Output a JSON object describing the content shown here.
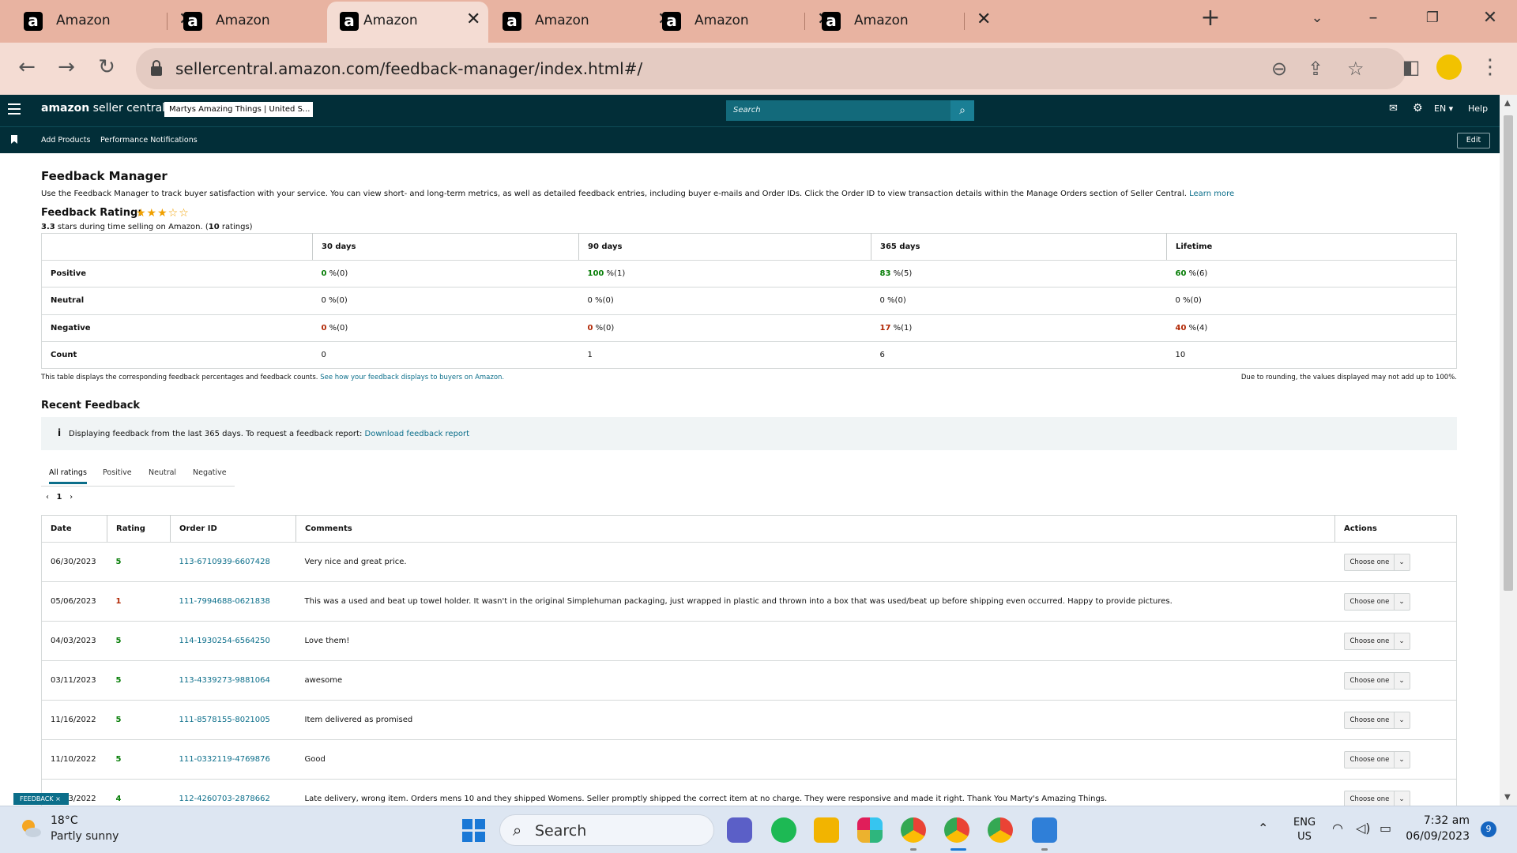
{
  "browser": {
    "tabs": [
      {
        "title": "Amazon",
        "active": false
      },
      {
        "title": "Amazon",
        "active": false
      },
      {
        "title": "Amazon",
        "active": true
      },
      {
        "title": "Amazon",
        "active": false
      },
      {
        "title": "Amazon",
        "active": false
      },
      {
        "title": "Amazon",
        "active": false
      }
    ],
    "url": "sellercentral.amazon.com/feedback-manager/index.html#/"
  },
  "header": {
    "logo_bold": "amazon",
    "logo_rest": " seller central",
    "account": "Martys Amazing Things | United S...",
    "search_placeholder": "Search",
    "language": "EN ▾",
    "help": "Help"
  },
  "subnav": {
    "links": [
      "Add Products",
      "Performance Notifications"
    ],
    "edit": "Edit"
  },
  "page": {
    "title": "Feedback Manager",
    "description": "Use the Feedback Manager to track buyer satisfaction with your service. You can view short- and long-term metrics, as well as detailed feedback entries, including buyer e-mails and Order IDs. Click the Order ID to view transaction details within the Manage Orders section of Seller Central.",
    "learn_more": "Learn more",
    "rating_label": "Feedback Rating:",
    "rating_value": 3.3,
    "rating_stars_text": "★★★☆☆",
    "rating_sub_bold": "3.3",
    "rating_sub_mid": " stars during time selling on Amazon. (",
    "rating_sub_count": "10",
    "rating_sub_end": " ratings)"
  },
  "metrics": {
    "columns": [
      "30 days",
      "90 days",
      "365 days",
      "Lifetime"
    ],
    "rows": [
      {
        "label": "Positive",
        "cells": [
          [
            "0",
            " %(0)"
          ],
          [
            "100",
            " %(1)"
          ],
          [
            "83",
            " %(5)"
          ],
          [
            "60",
            " %(6)"
          ]
        ]
      },
      {
        "label": "Neutral",
        "cells": [
          [
            "0",
            " %(0)"
          ],
          [
            "0",
            " %(0)"
          ],
          [
            "0",
            " %(0)"
          ],
          [
            "0",
            " %(0)"
          ]
        ]
      },
      {
        "label": "Negative",
        "cells": [
          [
            "0",
            " %(0)"
          ],
          [
            "0",
            " %(0)"
          ],
          [
            "17",
            " %(1)"
          ],
          [
            "40",
            " %(4)"
          ]
        ]
      },
      {
        "label": "Count",
        "cells": [
          [
            "0",
            ""
          ],
          [
            "1",
            ""
          ],
          [
            "6",
            ""
          ],
          [
            "10",
            ""
          ]
        ]
      }
    ],
    "note_left": "This table displays the corresponding feedback percentages and feedback counts.",
    "note_link": "See how your feedback displays to buyers on Amazon.",
    "note_right": "Due to rounding, the values displayed may not add up to 100%."
  },
  "recent": {
    "title": "Recent Feedback",
    "alert_text": "Displaying feedback from the last 365 days. To request a feedback report:",
    "alert_link": "Download feedback report",
    "filters": [
      "All ratings",
      "Positive",
      "Neutral",
      "Negative"
    ],
    "page": "1",
    "columns": [
      "Date",
      "Rating",
      "Order ID",
      "Comments",
      "Actions"
    ],
    "action_label": "Choose one",
    "rows": [
      {
        "date": "06/30/2023",
        "rating": "5",
        "order": "113-6710939-6607428",
        "comment": "Very nice and great price."
      },
      {
        "date": "05/06/2023",
        "rating": "1",
        "order": "111-7994688-0621838",
        "comment": "This was a used and beat up towel holder. It wasn't in the original Simplehuman packaging, just wrapped in plastic and thrown into a box that was used/beat up before shipping even occurred. Happy to provide pictures."
      },
      {
        "date": "04/03/2023",
        "rating": "5",
        "order": "114-1930254-6564250",
        "comment": "Love them!"
      },
      {
        "date": "03/11/2023",
        "rating": "5",
        "order": "113-4339273-9881064",
        "comment": "awesome"
      },
      {
        "date": "11/16/2022",
        "rating": "5",
        "order": "111-8578155-8021005",
        "comment": "Item delivered as promised"
      },
      {
        "date": "11/10/2022",
        "rating": "5",
        "order": "111-0332119-4769876",
        "comment": "Good"
      },
      {
        "date": "10/13/2022",
        "rating": "4",
        "order": "112-4260703-2878662",
        "comment": "Late delivery, wrong item. Orders mens 10 and they shipped Womens. Seller promptly shipped the correct item at no charge. They were responsive and made it right. Thank You Marty's Amazing Things."
      }
    ],
    "feedback_badge": "FEEDBACK ×"
  },
  "taskbar": {
    "temperature": "18°C",
    "condition": "Partly sunny",
    "search_label": "Search",
    "lang_line1": "ENG",
    "lang_line2": "US",
    "time": "7:32 am",
    "date": "06/09/2023",
    "notifications": "9"
  },
  "colors": {
    "tabbar": "#e8b3a1",
    "toolbar": "#f4dcd3",
    "sc_header": "#022e38",
    "link": "#0b6e8a",
    "positive": "#067d06",
    "negative": "#b12704"
  }
}
